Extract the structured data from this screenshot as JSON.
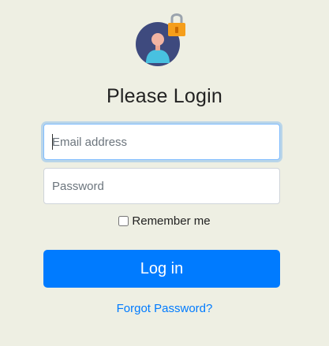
{
  "login": {
    "title": "Please Login",
    "email_placeholder": "Email address",
    "password_placeholder": "Password",
    "remember_label": "Remember me",
    "remember_checked": false,
    "login_button_label": "Log in",
    "forgot_link_label": "Forgot Password?"
  },
  "icons": {
    "avatar": "user-avatar-icon",
    "lock": "lock-icon"
  },
  "colors": {
    "background": "#eeefe3",
    "primary": "#007bff",
    "avatar_circle": "#3e4a7e",
    "avatar_person": "#48c1e0",
    "avatar_face": "#f2b4a3",
    "lock_body": "#f59e1b",
    "lock_shackle": "#9aa3ad"
  }
}
